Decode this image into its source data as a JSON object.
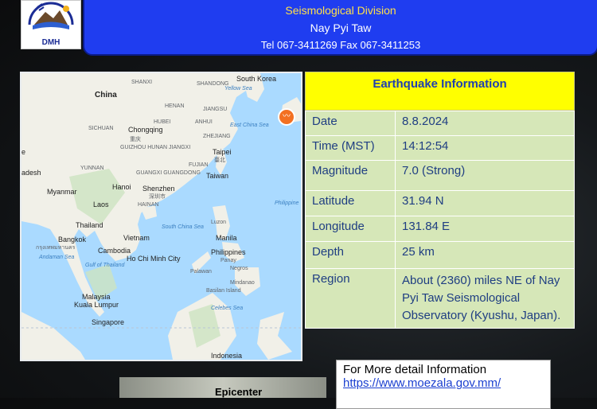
{
  "header": {
    "line1": "Seismological Division",
    "line2": "Nay Pyi Taw",
    "line3": "Tel 067-3411269 Fax 067-3411253"
  },
  "logo": {
    "text": "DMH"
  },
  "map": {
    "labels": {
      "south_korea": "South Korea",
      "china": "China",
      "shanxi": "SHANXI",
      "shandong": "SHANDONG",
      "yellow_sea": "Yellow Sea",
      "jiangsu": "JIANGSU",
      "henan": "HENAN",
      "hubei": "HUBEI",
      "anhui": "ANHUI",
      "sichuan": "SICHUAN",
      "chongqing": "Chongqing",
      "chongqing_zh": "重庆",
      "zhejiang": "ZHEJIANG",
      "east_china_sea": "East China Sea",
      "guizhou_hunan_jiangxi": "GUIZHOU HUNAN JIANGXI",
      "taipei": "Taipei",
      "taipei_zh": "臺北",
      "yunnan": "YUNNAN",
      "guangxi_guangdong": "GUANGXI GUANGDONG",
      "fujian": "FUJIAN",
      "taiwan": "Taiwan",
      "myanmar": "Myanmar",
      "hanoi": "Hanoi",
      "shenzhen": "Shenzhen",
      "shenzhen_zh": "深圳市",
      "laos": "Laos",
      "hainan": "HAINAN",
      "philippine": "Philippine",
      "thailand": "Thailand",
      "south_china_sea": "South China Sea",
      "luzon": "Luzon",
      "bangkok": "Bangkok",
      "bangkok_th": "กรุงเทพมหานคร",
      "vietnam": "Vietnam",
      "manila": "Manila",
      "andaman_sea": "Andaman Sea",
      "cambodia": "Cambodia",
      "gulf_of_thailand": "Gulf of Thailand",
      "ho_chi_minh": "Ho Chi Minh City",
      "philippines": "Philippines",
      "panay": "Panay",
      "negros": "Negros",
      "palawan": "Palawan",
      "mindanao": "Mindanao",
      "basilan_island": "Basilan Island",
      "malaysia": "Malaysia",
      "kuala_lumpur": "Kuala Lumpur",
      "celebes_sea": "Celebes Sea",
      "singapore": "Singapore",
      "indonesia": "Indonesia",
      "desh": "adesh",
      "edge_e": "e"
    }
  },
  "info": {
    "title": "Earthquake Information",
    "rows": [
      {
        "label": "Date",
        "value": "8.8.2024"
      },
      {
        "label": "Time (MST)",
        "value": "14:12:54"
      },
      {
        "label": "Magnitude",
        "value": "7.0 (Strong)"
      },
      {
        "label": "Latitude",
        "value": "31.94 N"
      },
      {
        "label": "Longitude",
        "value": "131.84 E"
      },
      {
        "label": "Depth",
        "value": "25 km"
      },
      {
        "label": "Region",
        "value": "About (2360) miles NE of Nay Pyi Taw Seismological Observatory (Kyushu, Japan)."
      }
    ]
  },
  "more": {
    "label": "For More detail Information",
    "link": "https://www.moezala.gov.mm/"
  },
  "epicenter": "Epicenter"
}
